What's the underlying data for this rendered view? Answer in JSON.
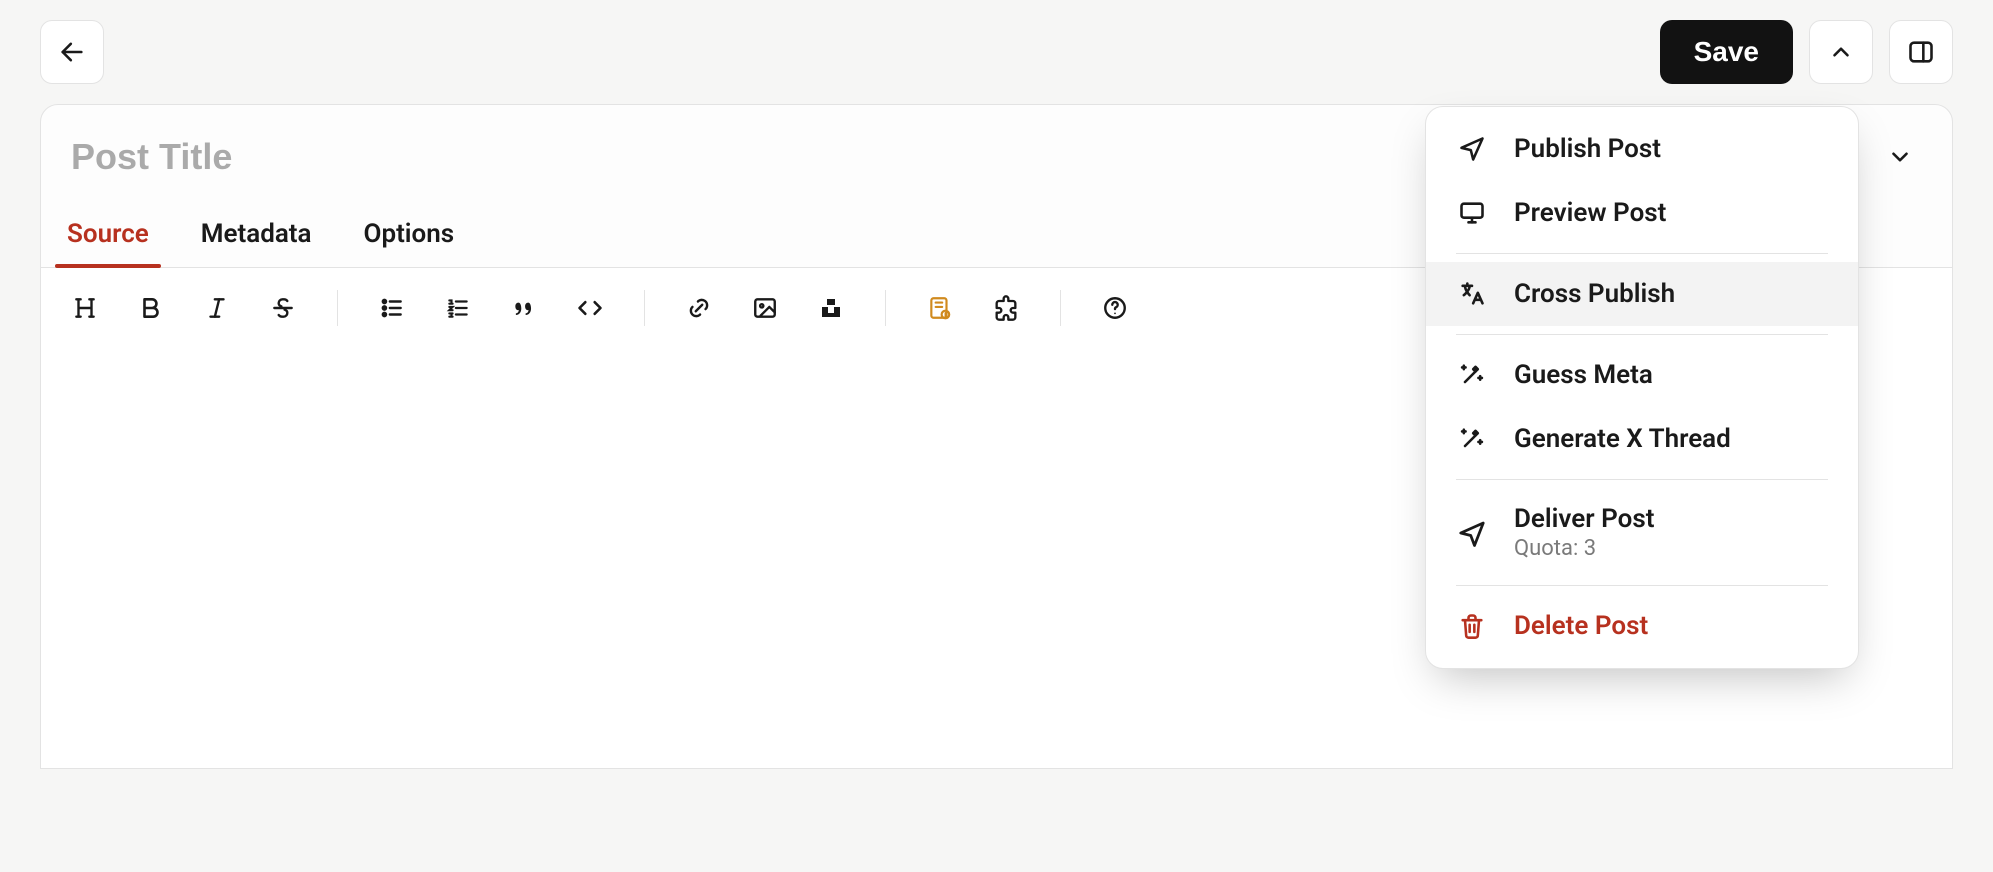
{
  "topbar": {
    "save_label": "Save"
  },
  "post": {
    "title_value": "",
    "title_placeholder": "Post Title"
  },
  "tabs": {
    "source": "Source",
    "metadata": "Metadata",
    "options": "Options"
  },
  "menu": {
    "publish": "Publish Post",
    "preview": "Preview Post",
    "cross_publish": "Cross Publish",
    "guess_meta": "Guess Meta",
    "gen_x_thread": "Generate X Thread",
    "deliver": "Deliver Post",
    "deliver_sub": "Quota: 3",
    "delete": "Delete Post"
  },
  "toolbar_icons": {
    "heading": "heading",
    "bold": "bold",
    "italic": "italic",
    "strike": "strike",
    "ul": "bulleted-list",
    "ol": "numbered-list",
    "quote": "quote",
    "code": "code",
    "link": "link",
    "image": "image",
    "upload": "upload-media",
    "paywall": "paywall",
    "extension": "extension",
    "help": "help"
  }
}
